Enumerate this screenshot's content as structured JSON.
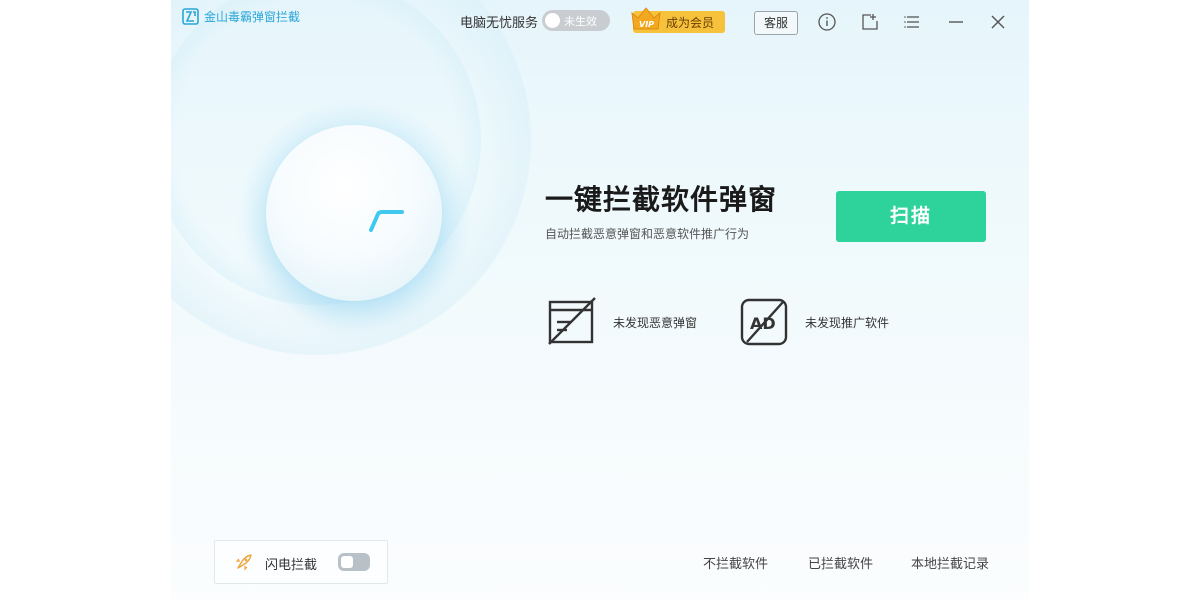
{
  "app": {
    "title": "金山毒霸弹窗拦截"
  },
  "header": {
    "service_label": "电脑无忧服务",
    "service_toggle_label": "未生效",
    "vip_badge_text": "VIP",
    "vip_label": "成为会员",
    "customer_service_label": "客服",
    "icons": [
      "info-icon",
      "share-icon",
      "menu-icon",
      "minimize-icon",
      "close-icon"
    ]
  },
  "main": {
    "headline": "一键拦截软件弹窗",
    "subline": "自动拦截恶意弹窗和恶意软件推广行为",
    "scan_label": "扫描",
    "status_items": [
      {
        "icon": "popup-window-icon",
        "text": "未发现恶意弹窗"
      },
      {
        "icon": "ad-block-icon",
        "text": "未发现推广软件",
        "icon_text": "AD"
      }
    ]
  },
  "footer": {
    "flash_block_label": "闪电拦截",
    "flash_block_enabled": false,
    "links": [
      "不拦截软件",
      "已拦截软件",
      "本地拦截记录"
    ]
  },
  "colors": {
    "accent_green": "#2ed39b",
    "brand_blue": "#2aa6d8",
    "vip_gold": "#f6c23b",
    "orb_mark": "#3fc8f0"
  }
}
